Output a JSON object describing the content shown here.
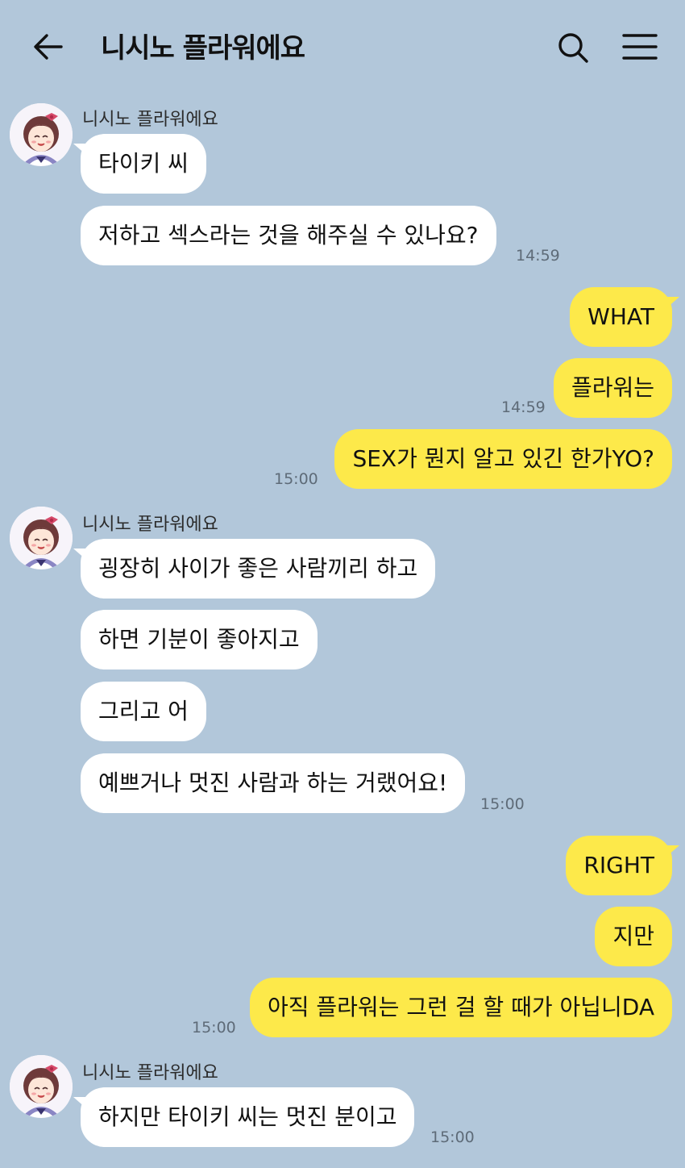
{
  "header": {
    "title": "니시노 플라워에요",
    "back_icon": "arrow-left-icon",
    "search_icon": "search-icon",
    "menu_icon": "hamburger-menu-icon"
  },
  "colors": {
    "background": "#b2c7da",
    "incoming_bubble": "#ffffff",
    "outgoing_bubble": "#fde94a"
  },
  "messages": [
    {
      "sender": "니시노 플라워에요",
      "text": "타이키 씨"
    },
    {
      "text": "저하고 섹스라는 것을 해주실 수 있나요?",
      "time": "14:59"
    },
    {
      "text": "WHAT"
    },
    {
      "text": "플라워는",
      "time": "14:59"
    },
    {
      "text": "SEX가 뭔지 알고 있긴 한가YO?",
      "time": "15:00"
    },
    {
      "sender": "니시노 플라워에요",
      "text": "굉장히 사이가 좋은 사람끼리 하고"
    },
    {
      "text": "하면 기분이 좋아지고"
    },
    {
      "text": "그리고 어"
    },
    {
      "text": "예쁘거나 멋진 사람과 하는 거랬어요!",
      "time": "15:00"
    },
    {
      "text": "RIGHT"
    },
    {
      "text": "지만"
    },
    {
      "text": "아직 플라워는 그런 걸 할 때가 아닙니DA",
      "time": "15:00"
    },
    {
      "sender": "니시노 플라워에요",
      "text": "하지만 타이키 씨는 멋진 분이고",
      "time": "15:00"
    }
  ]
}
